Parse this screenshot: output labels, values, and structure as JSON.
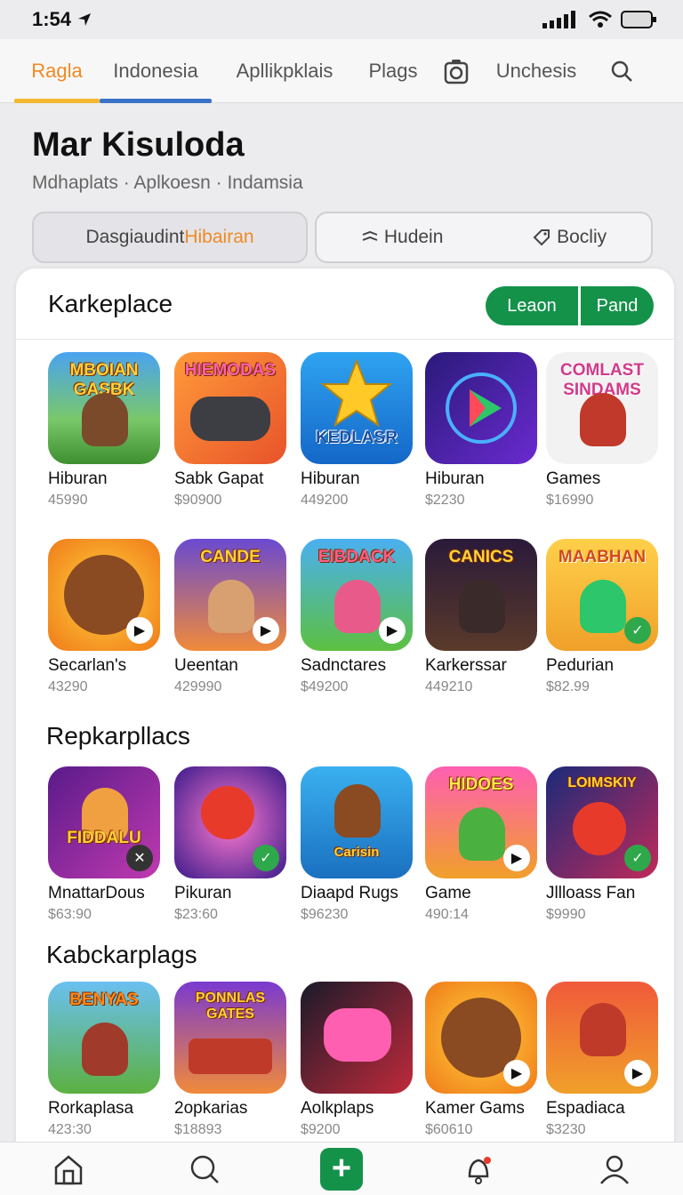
{
  "status": {
    "time": "1:54"
  },
  "topnav": {
    "tabs": [
      {
        "label": "Ragla",
        "active": true,
        "bar": "#f5b731"
      },
      {
        "label": "Indonesia",
        "active": false,
        "bar": "#3a72c8"
      },
      {
        "label": "Apllikpklais",
        "active": false,
        "bar": null
      },
      {
        "label": "Plags",
        "active": false,
        "bar": null
      },
      {
        "label": "Unchesis",
        "active": false,
        "bar": null
      }
    ]
  },
  "header": {
    "title": "Mar Kisuloda",
    "breadcrumb": "Mdhaplats · Aplkoesn · Indamsia",
    "pill1_prefix": "Dasgiaudint ",
    "pill1_highlight": "Hibairan",
    "pill2_a": "Hudein",
    "pill2_b": "Bocliy"
  },
  "card": {
    "title": "Karkeplace",
    "btn1": "Leaon",
    "btn2": "Pand",
    "section2": "Repkarpllacs",
    "section3": "Kabckarplags"
  },
  "apps": {
    "row1": [
      {
        "name": "Hiburan",
        "price": "45990",
        "word": "MBOIAN GASBK"
      },
      {
        "name": "Sabk Gapat",
        "price": "$90900",
        "word": "HIEMODAS"
      },
      {
        "name": "Hiburan",
        "price": "449200",
        "word": "KEDLASR"
      },
      {
        "name": "Hiburan",
        "price": "$2230",
        "word": ""
      },
      {
        "name": "Games",
        "price": "$16990",
        "word": "COMLAST SINDAMS"
      }
    ],
    "row2": [
      {
        "name": "Secarlan's",
        "price": "43290",
        "word": ""
      },
      {
        "name": "Ueentan",
        "price": "429990",
        "word": "CANDE"
      },
      {
        "name": "Sadnctares",
        "price": "$49200",
        "word": "EIBDACK"
      },
      {
        "name": "Karkerssar",
        "price": "449210",
        "word": "CANICS"
      },
      {
        "name": "Pedurian",
        "price": "$82.99",
        "word": "MAABHAN"
      }
    ],
    "row3": [
      {
        "name": "MnattarDous",
        "price": "$63:90",
        "word": "FIDDALU"
      },
      {
        "name": "Pikuran",
        "price": "$23:60",
        "word": ""
      },
      {
        "name": "Diaapd Rugs",
        "price": "$96230",
        "word": "Carisin"
      },
      {
        "name": "Game",
        "price": "490:14",
        "word": "HIDOES"
      },
      {
        "name": "Jllloass Fan",
        "price": "$9990",
        "word": "LOIMSKIY"
      }
    ],
    "row4": [
      {
        "name": "Rorkaplasa",
        "price": "423:30",
        "word": "BENYAS"
      },
      {
        "name": "2opkarias",
        "price": "$18893",
        "word": "PONNLAS GATES"
      },
      {
        "name": "Aolkplaps",
        "price": "$9200",
        "word": ""
      },
      {
        "name": "Kamer Gams",
        "price": "$60610",
        "word": ""
      },
      {
        "name": "Espadiaca",
        "price": "$3230",
        "word": ""
      }
    ]
  },
  "colors": {
    "accent": "#f08a24",
    "green": "#14924a"
  }
}
